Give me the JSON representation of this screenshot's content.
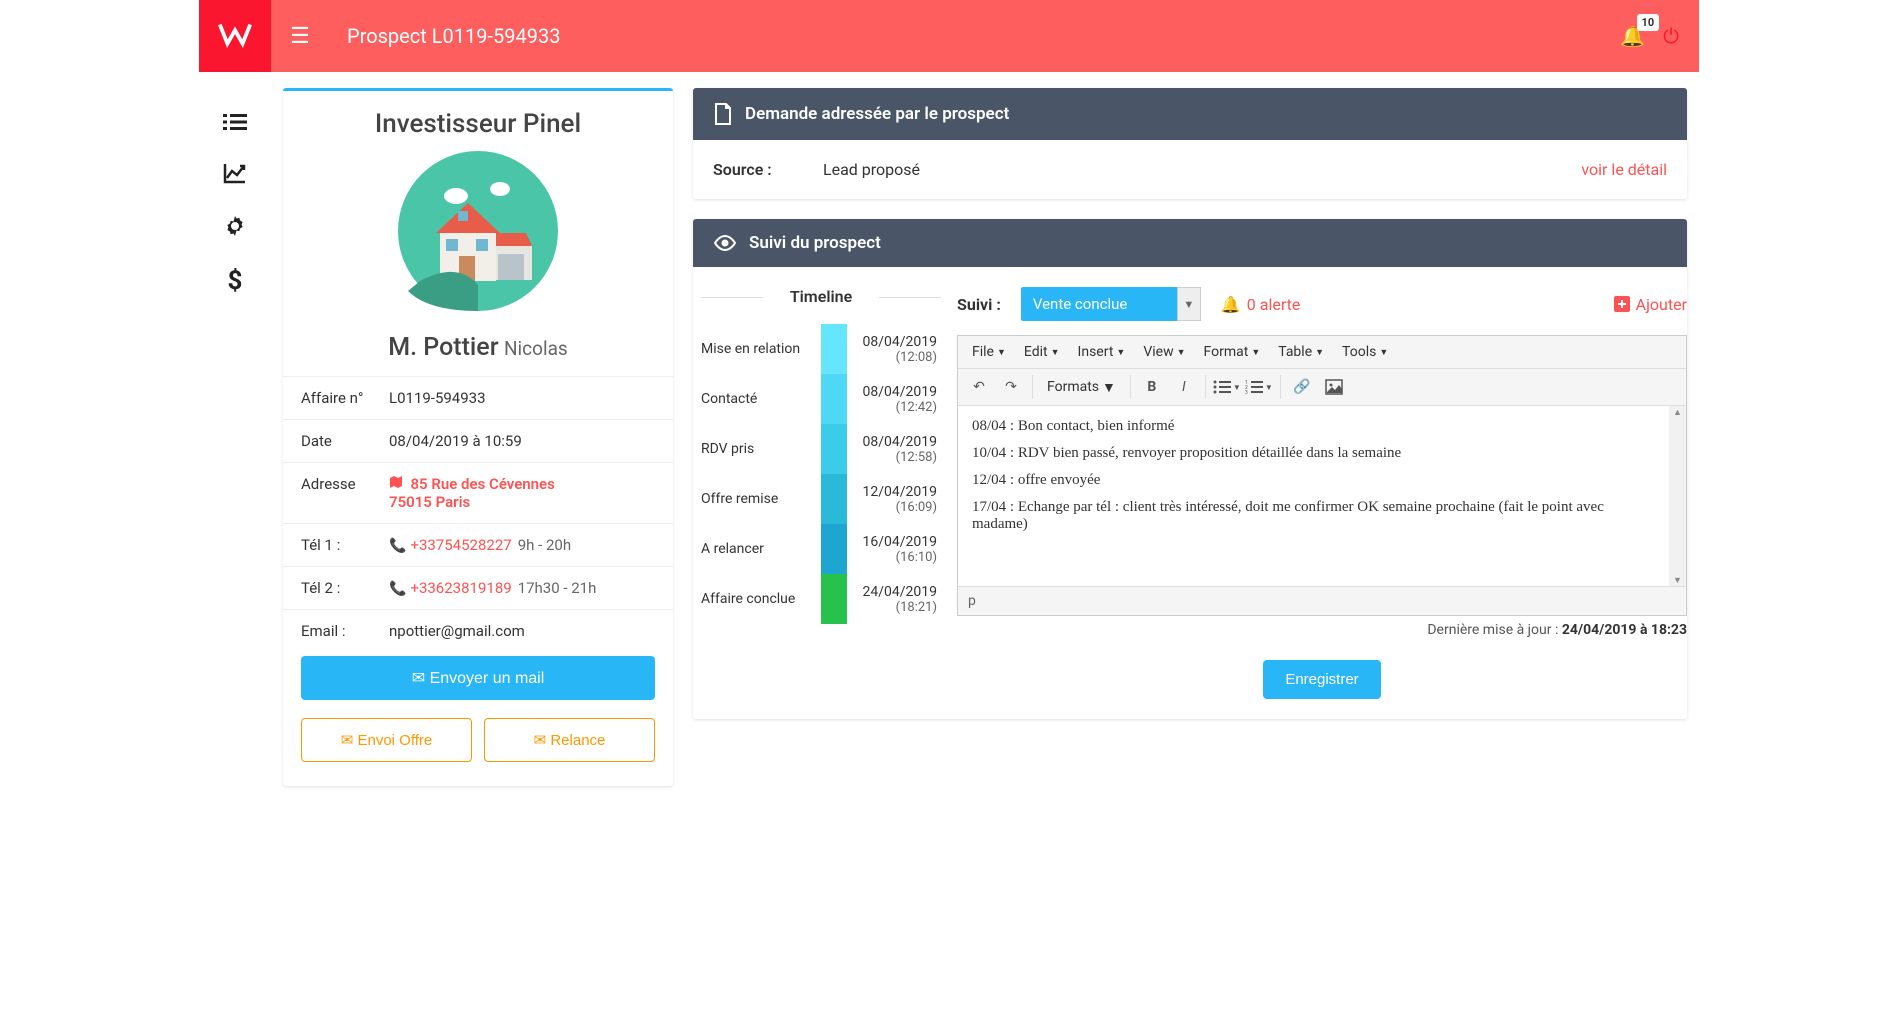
{
  "header": {
    "title": "Prospect L0119-594933",
    "notification_count": "10"
  },
  "profile": {
    "title": "Investisseur Pinel",
    "name_prefix": "M.",
    "last_name": "Pottier",
    "first_name": "Nicolas",
    "info": {
      "affaire_label": "Affaire n°",
      "affaire_value": "L0119-594933",
      "date_label": "Date",
      "date_value": "08/04/2019 à 10:59",
      "adresse_label": "Adresse",
      "adresse_line1": "85 Rue des Cévennes",
      "adresse_line2": "75015 Paris",
      "tel1_label": "Tél 1 :",
      "tel1_value": "+33754528227",
      "tel1_hours": "9h - 20h",
      "tel2_label": "Tél 2 :",
      "tel2_value": "+33623819189",
      "tel2_hours": "17h30 - 21h",
      "email_label": "Email :",
      "email_value": "npottier@gmail.com"
    },
    "buttons": {
      "send_mail": "Envoyer un mail",
      "send_offer": "Envoi Offre",
      "relance": "Relance"
    }
  },
  "demande": {
    "header": "Demande adressée par le prospect",
    "source_label": "Source :",
    "source_value": "Lead proposé",
    "detail_link": "voir le détail"
  },
  "suivi": {
    "header": "Suivi du prospect",
    "timeline_title": "Timeline",
    "timeline": [
      {
        "label": "Mise en relation",
        "date": "08/04/2019",
        "time": "(12:08)",
        "color": "#66e5ff"
      },
      {
        "label": "Contacté",
        "date": "08/04/2019",
        "time": "(12:42)",
        "color": "#4ed8f5"
      },
      {
        "label": "RDV pris",
        "date": "08/04/2019",
        "time": "(12:58)",
        "color": "#3acce8"
      },
      {
        "label": "Offre remise",
        "date": "12/04/2019",
        "time": "(16:09)",
        "color": "#2bb9d9"
      },
      {
        "label": "A relancer",
        "date": "16/04/2019",
        "time": "(16:10)",
        "color": "#1ea5d1"
      },
      {
        "label": "Affaire conclue",
        "date": "24/04/2019",
        "time": "(18:21)",
        "color": "#27c24c"
      }
    ],
    "suivi_label": "Suivi :",
    "suivi_status": "Vente conclue",
    "alert_text": "0 alerte",
    "add_text": "Ajouter",
    "editor_menus": [
      "File",
      "Edit",
      "Insert",
      "View",
      "Format",
      "Table",
      "Tools"
    ],
    "formats_label": "Formats",
    "notes": [
      "08/04 : Bon contact, bien informé",
      "10/04 : RDV bien passé, renvoyer proposition détaillée dans la semaine",
      "12/04 : offre envoyée",
      "17/04 : Echange par tél : client très intéressé, doit me confirmer OK semaine prochaine (fait le point avec madame)"
    ],
    "editor_path": "p",
    "last_update_label": "Dernière mise à jour : ",
    "last_update_value": "24/04/2019 à 18:23",
    "save_button": "Enregistrer"
  }
}
